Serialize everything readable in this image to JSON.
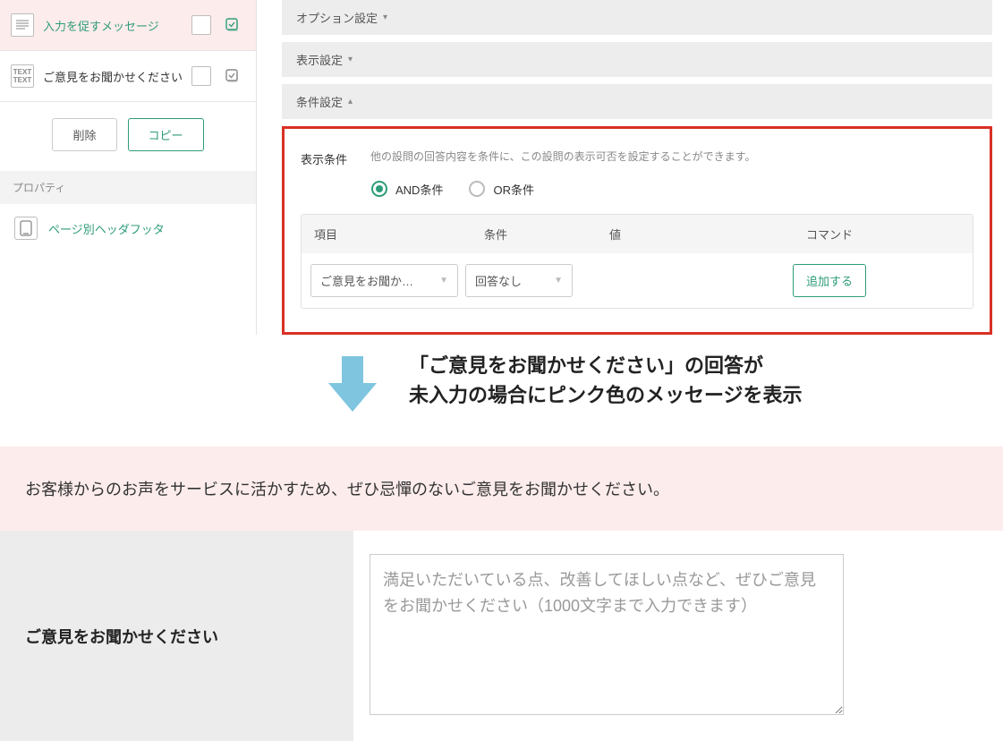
{
  "sidebar": {
    "items": [
      {
        "label": "入力を促すメッセージ",
        "icon": "lines"
      },
      {
        "label": "ご意見をお聞かせください",
        "icon": "text"
      }
    ],
    "delete_label": "削除",
    "copy_label": "コピー",
    "properties_heading": "プロパティ",
    "page_hf_label": "ページ別ヘッダフッタ"
  },
  "main": {
    "accordions": {
      "option": "オプション設定",
      "display": "表示設定",
      "condition": "条件設定"
    },
    "condition": {
      "label": "表示条件",
      "description": "他の設問の回答内容を条件に、この設問の表示可否を設定することができます。",
      "and_label": "AND条件",
      "or_label": "OR条件",
      "headers": {
        "item": "項目",
        "cond": "条件",
        "val": "値",
        "cmd": "コマンド"
      },
      "selected": {
        "item": "ご意見をお聞か…",
        "cond": "回答なし"
      },
      "add_label": "追加する"
    }
  },
  "annotation": {
    "line1": "「ご意見をお聞かせください」の回答が",
    "line2": "未入力の場合にピンク色のメッセージを表示"
  },
  "preview": {
    "banner": "お客様からのお声をサービスに活かすため、ぜひ忌憚のないご意見をお聞かせください。",
    "label": "ご意見をお聞かせください",
    "placeholder": "満足いただいている点、改善してほしい点など、ぜひご意見をお聞かせください（1000文字まで入力できます）"
  }
}
